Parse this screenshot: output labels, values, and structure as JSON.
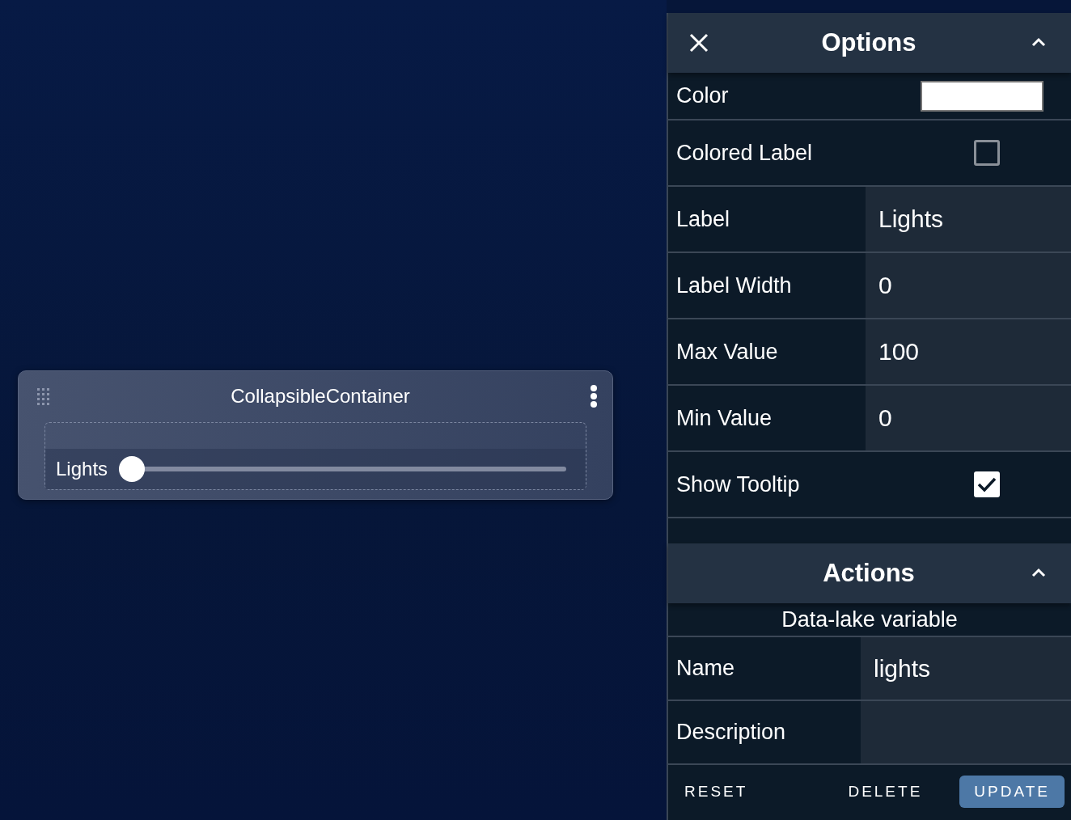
{
  "widget": {
    "title": "CollapsibleContainer",
    "slider": {
      "label": "Lights",
      "level": 0
    }
  },
  "options": {
    "title": "Options",
    "expanded": true,
    "fields": [
      {
        "kind": "color",
        "label": "Color",
        "color": "#ffffff"
      },
      {
        "kind": "checkbox",
        "label": "Colored Label",
        "checked": false
      },
      {
        "kind": "text",
        "label": "Label",
        "value": "Lights"
      },
      {
        "kind": "text",
        "label": "Label Width",
        "value": "0"
      },
      {
        "kind": "text",
        "label": "Max Value",
        "value": "100"
      },
      {
        "kind": "text",
        "label": "Min Value",
        "value": "0"
      },
      {
        "kind": "checkbox",
        "label": "Show Tooltip",
        "checked": true
      }
    ]
  },
  "actions": {
    "title": "Actions",
    "expanded": true,
    "subtitle": "Data-lake variable",
    "fields": [
      {
        "label": "Name",
        "value": "lights"
      },
      {
        "label": "Description"
      }
    ],
    "buttons": [
      {
        "label": "RESET",
        "kind": "text"
      },
      {
        "label": "DELETE",
        "kind": "text"
      },
      {
        "label": "UPDATE",
        "kind": "primary"
      }
    ]
  }
}
